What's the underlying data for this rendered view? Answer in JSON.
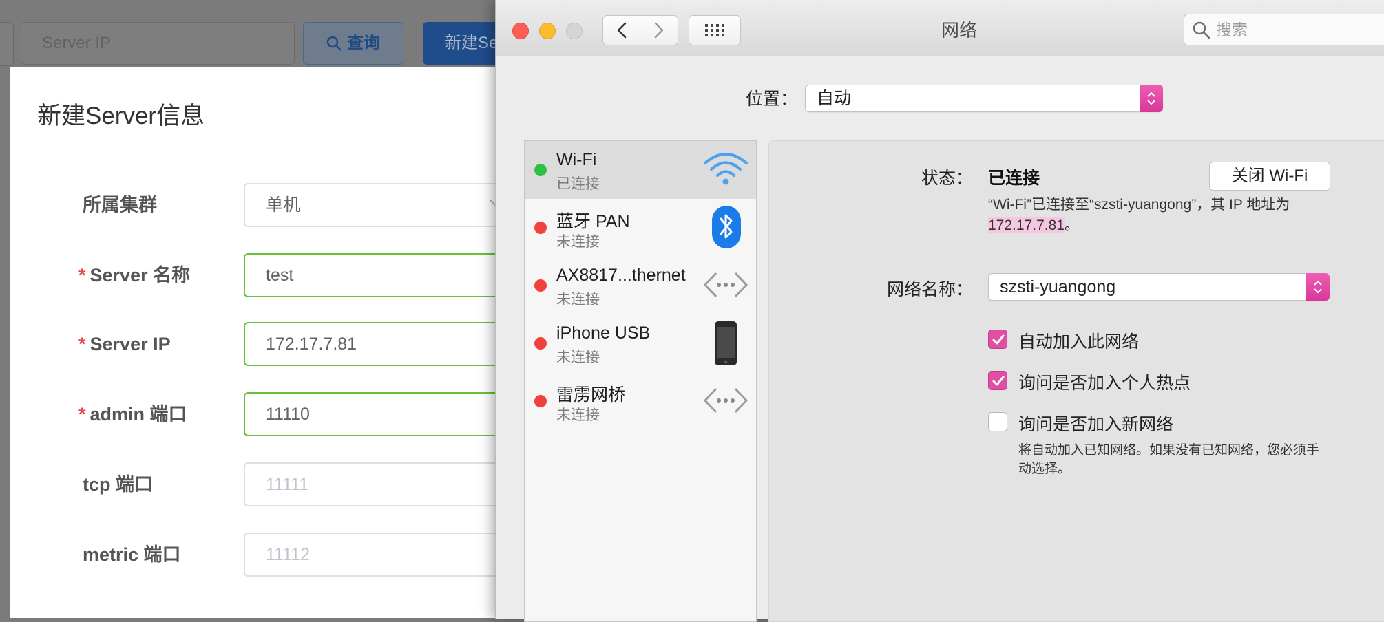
{
  "web_app": {
    "search_placeholder": "Server IP",
    "query_button": "查询",
    "new_button": "新建Se",
    "dialog": {
      "title": "新建Server信息",
      "fields": [
        {
          "label": "所属集群",
          "required": "",
          "value": "单机",
          "placeholder": ""
        },
        {
          "label": "Server 名称",
          "required": "*",
          "value": "test",
          "placeholder": ""
        },
        {
          "label": "Server IP",
          "required": "*",
          "value": "172.17.7.81",
          "placeholder": ""
        },
        {
          "label": "admin 端口",
          "required": "*",
          "value": "11110",
          "placeholder": ""
        },
        {
          "label": "tcp 端口",
          "required": "",
          "value": "",
          "placeholder": "11111"
        },
        {
          "label": "metric 端口",
          "required": "",
          "value": "",
          "placeholder": "11112"
        }
      ]
    }
  },
  "mac_window": {
    "title": "网络",
    "search_placeholder": "搜索",
    "location_label": "位置：",
    "location_value": "自动",
    "services": [
      {
        "name": "Wi-Fi",
        "status": "已连接",
        "dot": "green",
        "icon": "wifi-icon"
      },
      {
        "name": "蓝牙 PAN",
        "status": "未连接",
        "dot": "red",
        "icon": "bluetooth-icon"
      },
      {
        "name": "AX8817...thernet",
        "status": "未连接",
        "dot": "red",
        "icon": "ethernet-icon"
      },
      {
        "name": "iPhone USB",
        "status": "未连接",
        "dot": "red",
        "icon": "iphone-icon"
      },
      {
        "name": "雷雳网桥",
        "status": "未连接",
        "dot": "red",
        "icon": "bridge-icon"
      }
    ],
    "detail": {
      "status_label": "状态：",
      "status_value": "已连接",
      "turn_off_button": "关闭 Wi-Fi",
      "status_desc_prefix": "“Wi-Fi”已连接至“szsti-yuangong”，其 IP 地址为",
      "ip_address": "172.17.7.81",
      "status_desc_suffix": "。",
      "network_name_label": "网络名称：",
      "network_name_value": "szsti-yuangong",
      "options": [
        {
          "label": "自动加入此网络",
          "checked": true
        },
        {
          "label": "询问是否加入个人热点",
          "checked": true
        },
        {
          "label": "询问是否加入新网络",
          "checked": false
        }
      ],
      "note": "将自动加入已知网络。如果没有已知网络，您必须手动选择。"
    }
  },
  "colors": {
    "accent_pink": "#e04fa6",
    "connected_green": "#2ec043",
    "disconnected_red": "#f1413d",
    "valid_border": "#67c23a"
  }
}
